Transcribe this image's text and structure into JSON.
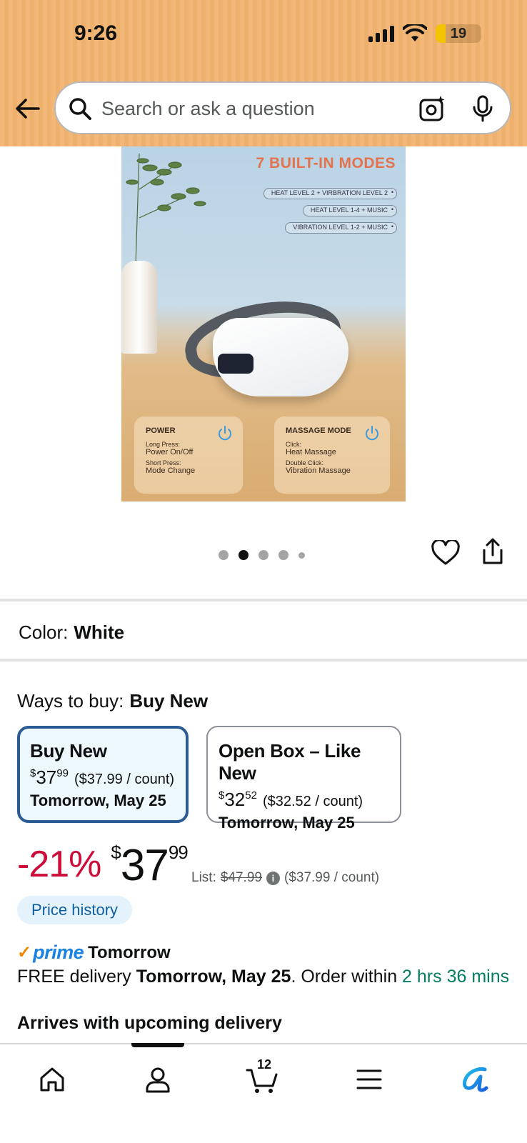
{
  "status_bar": {
    "time": "9:26",
    "battery": "19"
  },
  "search": {
    "placeholder": "Search or ask a question"
  },
  "product_image": {
    "title": "7 BUILT-IN MODES",
    "modes": [
      "HEAT LEVEL 2 + VIRBRATION LEVEL 2",
      "HEAT LEVEL 1-4 + MUSIC",
      "VIBRATION LEVEL 1-2 + MUSIC"
    ],
    "power_card": {
      "title": "POWER",
      "line1_small": "Long Press:",
      "line1": "Power On/Off",
      "line2_small": "Short Press:",
      "line2": "Mode Change"
    },
    "mode_card": {
      "title": "MASSAGE MODE",
      "line1_small": "Click:",
      "line1": "Heat Massage",
      "line2_small": "Double Click:",
      "line2": "Vibration Massage"
    }
  },
  "carousel": {
    "count": 5,
    "active_index": 1
  },
  "color": {
    "label": "Color:",
    "value": "White"
  },
  "ways_to_buy": {
    "label": "Ways to buy:",
    "value": "Buy New",
    "options": [
      {
        "title": "Buy New",
        "currency": "$",
        "whole": "37",
        "cents": "99",
        "per_count": "($37.99 / count)",
        "delivery": "Tomorrow, May 25",
        "selected": true
      },
      {
        "title": "Open Box – Like New",
        "currency": "$",
        "whole": "32",
        "cents": "52",
        "per_count": "($32.52 / count)",
        "delivery": "Tomorrow, May 25",
        "selected": false
      }
    ]
  },
  "price": {
    "discount": "-21%",
    "currency": "$",
    "whole": "37",
    "cents": "99",
    "list_label": "List:",
    "list_value": "$47.99",
    "per_count": "($37.99 / count)"
  },
  "price_history_label": "Price history",
  "prime": {
    "logo": "prime",
    "label": "Tomorrow"
  },
  "delivery": {
    "prefix": "FREE delivery ",
    "date": "Tomorrow, May 25",
    "middle": ". Order within ",
    "countdown": "2 hrs 36 mins"
  },
  "arrives": "Arrives with upcoming delivery",
  "bottom_nav": {
    "cart_count": "12"
  },
  "colors": {
    "header": "#f2b46f",
    "discount": "#cc0c39",
    "link": "#115fa3",
    "green": "#067d62",
    "prime": "#1a82e2",
    "selected_border": "#2a5c93"
  }
}
